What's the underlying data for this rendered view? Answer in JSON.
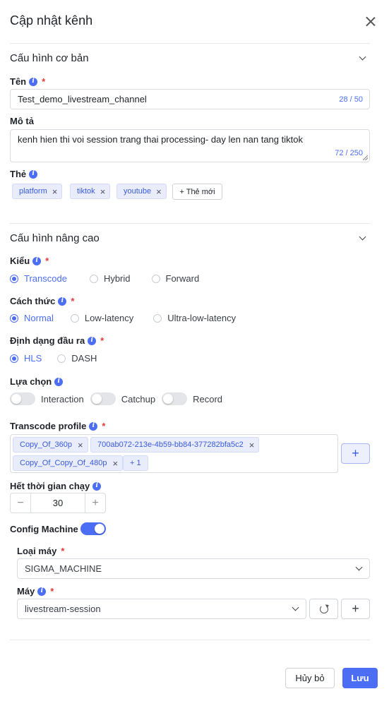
{
  "drawer": {
    "title": "Cập nhật kênh"
  },
  "basic": {
    "title": "Cấu hình cơ bản",
    "name_label": "Tên",
    "name_value": "Test_demo_livestream_channel",
    "name_counter": "28 / 50",
    "desc_label": "Mô tả",
    "desc_value": "kenh hien thi voi session trang thai processing- day len nan tang tiktok",
    "desc_counter": "72 / 250",
    "tags_label": "Thẻ",
    "tags": [
      "platform",
      "tiktok",
      "youtube"
    ],
    "new_tag_label": "+ Thẻ mới"
  },
  "advanced": {
    "title": "Cấu hình nâng cao",
    "type_label": "Kiểu",
    "type_options": [
      "Transcode",
      "Hybrid",
      "Forward"
    ],
    "type_selected": "Transcode",
    "method_label": "Cách thức",
    "method_options": [
      "Normal",
      "Low-latency",
      "Ultra-low-latency"
    ],
    "method_selected": "Normal",
    "format_label": "Định dạng đầu ra",
    "format_options": [
      "HLS",
      "DASH"
    ],
    "format_selected": "HLS",
    "options_label": "Lựa chọn",
    "toggles": [
      {
        "label": "Interaction",
        "on": false
      },
      {
        "label": "Catchup",
        "on": false
      },
      {
        "label": "Record",
        "on": false
      }
    ],
    "profile_label": "Transcode profile",
    "profiles": [
      "Copy_Of_360p",
      "700ab072-213e-4b59-bb84-377282bfa5c2",
      "Copy_Of_Copy_Of_480p"
    ],
    "profiles_more": "+ 1",
    "timeout_label": "Hết thời gian chạy",
    "timeout_value": "30",
    "config_machine_label": "Config Machine",
    "config_machine_on": true,
    "machine_type_label": "Loại máy",
    "machine_type_value": "SIGMA_MACHINE",
    "machine_label": "Máy",
    "machine_value": "livestream-session"
  },
  "footer": {
    "cancel_label": "Hủy bỏ",
    "save_label": "Lưu"
  },
  "colors": {
    "accent": "#4c6ef5",
    "required": "#e5383b",
    "tag_bg": "#e8ecfb"
  }
}
